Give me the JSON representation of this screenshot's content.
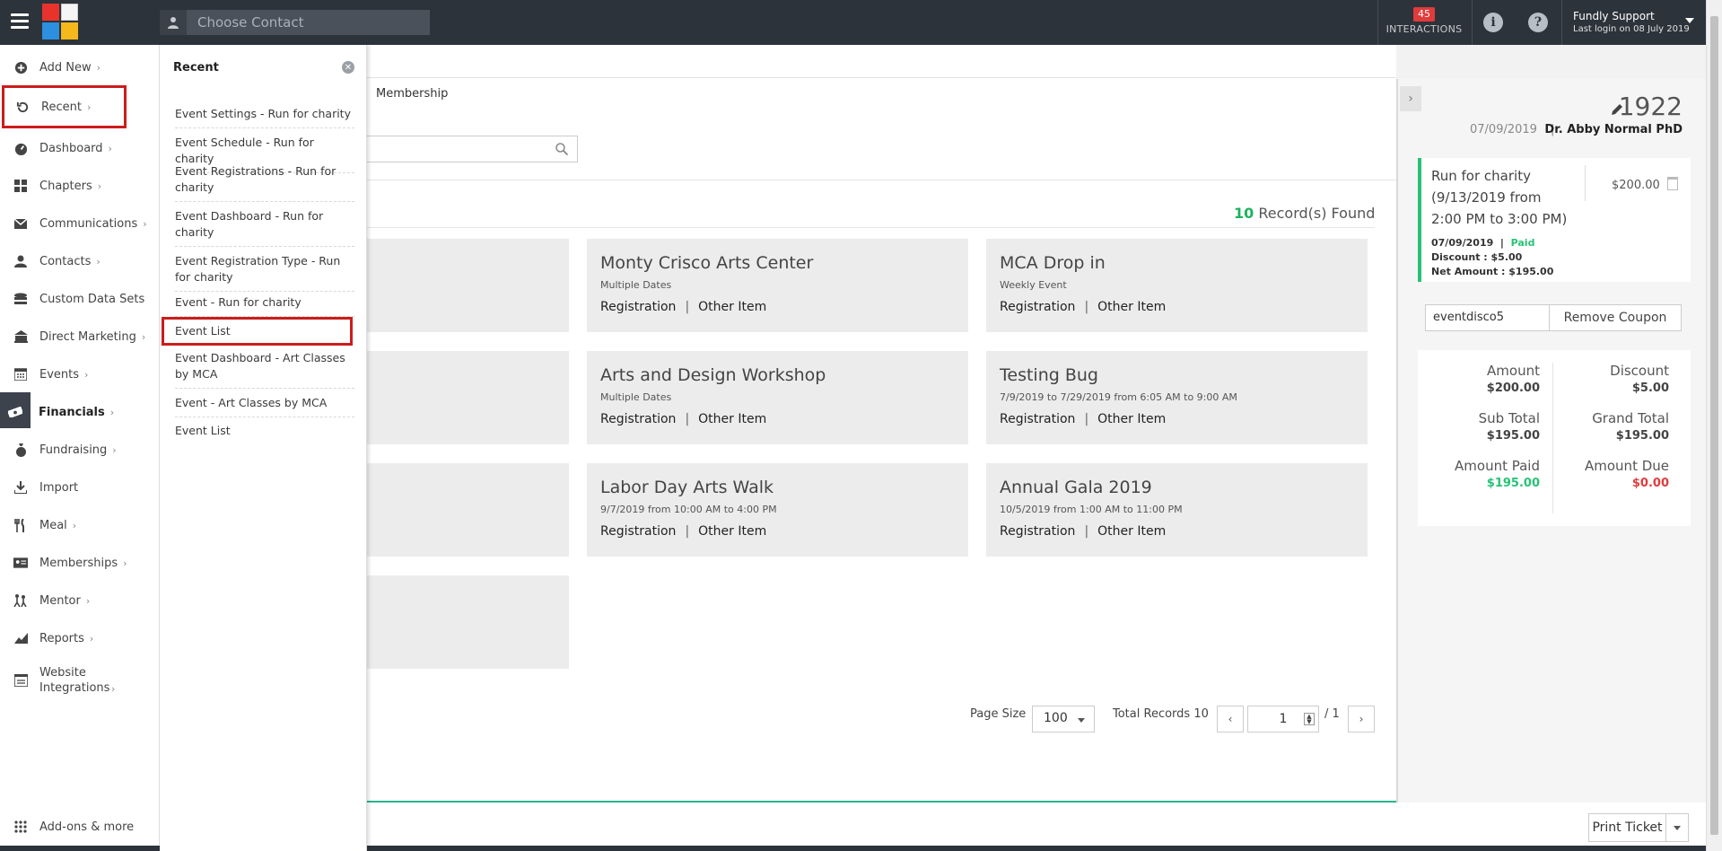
{
  "topbar": {
    "contact_placeholder": "Choose Contact",
    "interactions_count": "45",
    "interactions_label": "INTERACTIONS",
    "user_name": "Fundly Support",
    "last_login": "Last login on 08 July 2019"
  },
  "sidebar": {
    "items": [
      {
        "label": "Add New",
        "icon": "plus-circle-icon"
      },
      {
        "label": "Recent",
        "icon": "history-icon"
      },
      {
        "label": "Dashboard",
        "icon": "dashboard-icon"
      },
      {
        "label": "Chapters",
        "icon": "grid-icon"
      },
      {
        "label": "Communications",
        "icon": "envelope-icon"
      },
      {
        "label": "Contacts",
        "icon": "user-icon"
      },
      {
        "label": "Custom Data Sets",
        "icon": "database-icon"
      },
      {
        "label": "Direct Marketing",
        "icon": "bank-icon"
      },
      {
        "label": "Events",
        "icon": "calendar-icon"
      },
      {
        "label": "Financials",
        "icon": "money-icon"
      },
      {
        "label": "Fundraising",
        "icon": "moneybag-icon"
      },
      {
        "label": "Import",
        "icon": "download-icon"
      },
      {
        "label": "Meal",
        "icon": "utensils-icon"
      },
      {
        "label": "Memberships",
        "icon": "id-card-icon"
      },
      {
        "label": "Mentor",
        "icon": "mentor-icon"
      },
      {
        "label": "Reports",
        "icon": "chart-icon"
      },
      {
        "label": "Website Integrations",
        "icon": "website-icon"
      }
    ],
    "addons_label": "Add-ons & more"
  },
  "recent": {
    "title": "Recent",
    "items": [
      "Event Settings - Run for charity",
      "Event Schedule - Run for charity",
      "Event Registrations - Run for charity",
      "Event Dashboard - Run for charity",
      "Event Registration Type - Run for charity",
      "Event - Run for charity",
      "Event List",
      "Event Dashboard - Art Classes by MCA",
      "Event - Art Classes by MCA",
      "Event List"
    ]
  },
  "main": {
    "tab_label": "Membership",
    "records_count": "10",
    "records_label": "Record(s) Found",
    "link_registration": "Registration",
    "link_other": "Other Item",
    "link_sep": "|",
    "cards": [
      {
        "title": "Monty Crisco Arts Center",
        "sub": "Multiple Dates"
      },
      {
        "title": "MCA Drop in",
        "sub": "Weekly Event"
      },
      {
        "title": "Arts and Design Workshop",
        "sub": "Multiple Dates"
      },
      {
        "title": "Testing Bug",
        "sub": "7/9/2019 to 7/29/2019 from 6:05 AM to 9:00 AM"
      },
      {
        "title": "Labor Day Arts Walk",
        "sub": "9/7/2019 from 10:00 AM to 4:00 PM"
      },
      {
        "title": "Annual Gala 2019",
        "sub": "10/5/2019 from 1:00 AM to 11:00 PM"
      }
    ],
    "pager": {
      "page_size_label": "Page Size",
      "page_size": "100",
      "total_label": "Total Records 10",
      "prev": "‹",
      "page": "1",
      "of": "/ 1",
      "next": "›"
    },
    "print_label": "Print Ticket"
  },
  "ticket": {
    "number": "1922",
    "date": "07/09/2019",
    "separator": "|",
    "name": "Dr. Abby Normal PhD",
    "item_title": "Run for charity (9/13/2019 from 2:00 PM to 3:00 PM)",
    "item_amount": "$200.00",
    "item_date": "07/09/2019",
    "item_status": "Paid",
    "discount_line": "Discount : $5.00",
    "net_line": "Net Amount : $195.00",
    "coupon_code": "eventdisco5",
    "remove_coupon": "Remove Coupon",
    "totals": {
      "amount_label": "Amount",
      "amount": "$200.00",
      "discount_label": "Discount",
      "discount": "$5.00",
      "subtotal_label": "Sub Total",
      "subtotal": "$195.00",
      "grand_label": "Grand Total",
      "grand": "$195.00",
      "paid_label": "Amount Paid",
      "paid": "$195.00",
      "due_label": "Amount Due",
      "due": "$0.00"
    },
    "colors": {
      "paid": "#27c276",
      "due": "#e23b3b",
      "accent": "#27b58b",
      "highlight": "#cc1c1c"
    }
  }
}
